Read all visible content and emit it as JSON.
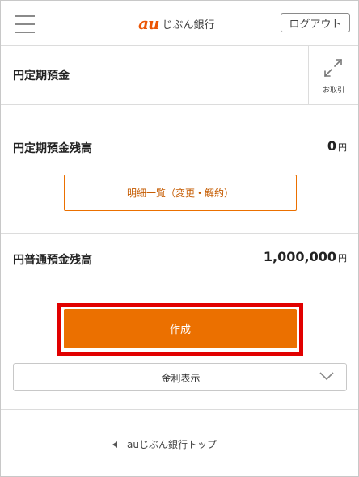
{
  "header": {
    "logo_mark": "au",
    "logo_text": "じぶん銀行",
    "logout_label": "ログアウト"
  },
  "page": {
    "title": "円定期預金",
    "transactions_label": "お取引"
  },
  "time_deposit": {
    "label": "円定期預金残高",
    "amount": "0",
    "unit": "円",
    "detail_button": "明細一覧（変更・解約）"
  },
  "ordinary_deposit": {
    "label": "円普通預金残高",
    "amount": "1,000,000",
    "unit": "円"
  },
  "create_button": "作成",
  "rate_select": {
    "selected": "金利表示"
  },
  "footer": {
    "top_link": "auじぶん銀行トップ"
  },
  "colors": {
    "accent": "#eb7000",
    "highlight": "#e10000",
    "logo": "#eb5505"
  },
  "icons": [
    "menu-icon",
    "expand-arrows-icon",
    "chevron-down-icon",
    "triangle-left-icon"
  ]
}
